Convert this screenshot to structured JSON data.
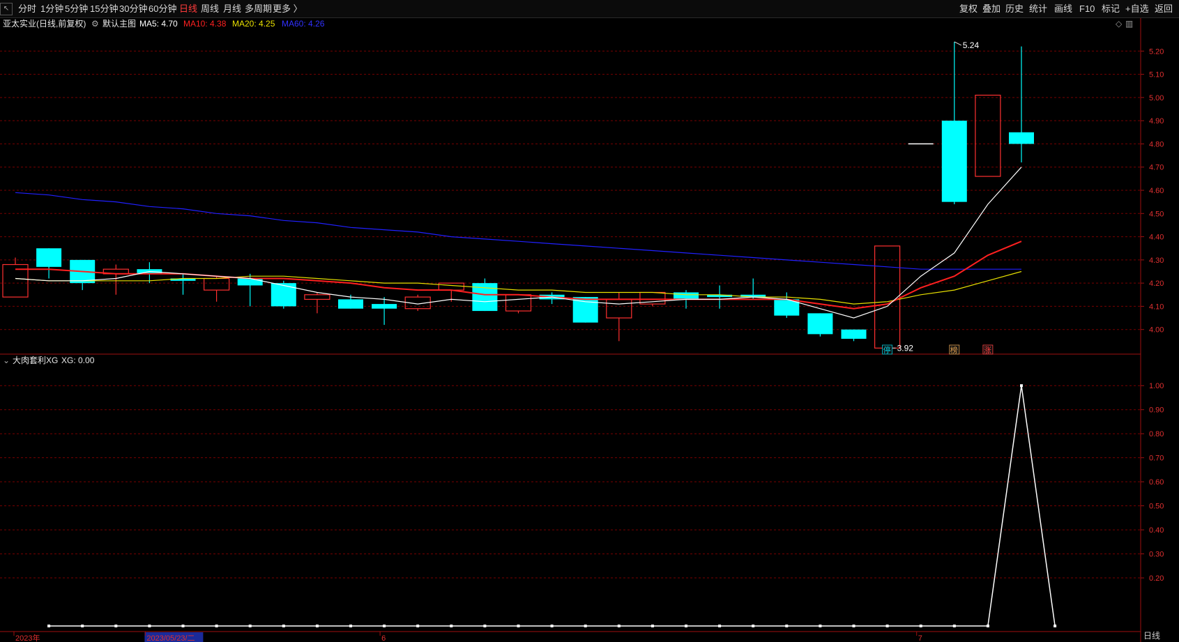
{
  "toolbar": {
    "left_items": [
      "分时",
      "1分钟",
      "5分钟",
      "15分钟",
      "30分钟",
      "60分钟",
      "日线",
      "周线",
      "月线",
      "多周期",
      "更多 〉"
    ],
    "active_item": "日线",
    "right_items": [
      "复权",
      "叠加",
      "历史",
      "统计",
      "画线",
      "F10",
      "标记",
      "+自选",
      "返回"
    ]
  },
  "header": {
    "stock_name": "亚太实业(日线,前复权)",
    "main_chart_label": "默认主图",
    "ma5": "MA5: 4.70",
    "ma10": "MA10: 4.38",
    "ma20": "MA20: 4.25",
    "ma60": "MA60: 4.26"
  },
  "indicator_header": {
    "name": "大肉套利XG",
    "value": "XG: 0.00"
  },
  "colors": {
    "up": "#ff3030",
    "down": "#00ffff",
    "ma5": "#ffffff",
    "ma10": "#ff2020",
    "ma20": "#e8e000",
    "ma60": "#2020ff",
    "grid": "#7a0000",
    "axis_text": "#e03030"
  },
  "chart_data": [
    {
      "type": "candlestick",
      "title": "亚太实业(日线,前复权)",
      "ylim": [
        3.9,
        5.3
      ],
      "yticks": [
        4.0,
        4.1,
        4.2,
        4.3,
        4.4,
        4.5,
        4.6,
        4.7,
        4.8,
        4.9,
        5.0,
        5.1,
        5.2
      ],
      "x_labels": [
        {
          "index": 0,
          "label": "2023年"
        },
        {
          "index": 4,
          "label": "2023/05/23/二"
        },
        {
          "index": 11,
          "label": "6"
        },
        {
          "index": 27,
          "label": "7"
        }
      ],
      "candles": [
        {
          "o": 4.14,
          "h": 4.31,
          "l": 4.14,
          "c": 4.28
        },
        {
          "o": 4.35,
          "h": 4.35,
          "l": 4.22,
          "c": 4.27
        },
        {
          "o": 4.3,
          "h": 4.3,
          "l": 4.17,
          "c": 4.2
        },
        {
          "o": 4.24,
          "h": 4.28,
          "l": 4.15,
          "c": 4.26
        },
        {
          "o": 4.26,
          "h": 4.29,
          "l": 4.2,
          "c": 4.24
        },
        {
          "o": 4.22,
          "h": 4.24,
          "l": 4.15,
          "c": 4.21
        },
        {
          "o": 4.17,
          "h": 4.23,
          "l": 4.12,
          "c": 4.22
        },
        {
          "o": 4.22,
          "h": 4.24,
          "l": 4.1,
          "c": 4.19
        },
        {
          "o": 4.2,
          "h": 4.21,
          "l": 4.09,
          "c": 4.1
        },
        {
          "o": 4.13,
          "h": 4.16,
          "l": 4.07,
          "c": 4.15
        },
        {
          "o": 4.13,
          "h": 4.15,
          "l": 4.09,
          "c": 4.09
        },
        {
          "o": 4.11,
          "h": 4.14,
          "l": 4.02,
          "c": 4.09
        },
        {
          "o": 4.09,
          "h": 4.15,
          "l": 4.08,
          "c": 4.14
        },
        {
          "o": 4.17,
          "h": 4.2,
          "l": 4.12,
          "c": 4.2
        },
        {
          "o": 4.2,
          "h": 4.22,
          "l": 4.08,
          "c": 4.08
        },
        {
          "o": 4.08,
          "h": 4.15,
          "l": 4.07,
          "c": 4.15
        },
        {
          "o": 4.15,
          "h": 4.16,
          "l": 4.11,
          "c": 4.13
        },
        {
          "o": 4.14,
          "h": 4.14,
          "l": 4.03,
          "c": 4.03
        },
        {
          "o": 4.05,
          "h": 4.16,
          "l": 3.95,
          "c": 4.13
        },
        {
          "o": 4.11,
          "h": 4.16,
          "l": 4.1,
          "c": 4.16
        },
        {
          "o": 4.16,
          "h": 4.17,
          "l": 4.09,
          "c": 4.13
        },
        {
          "o": 4.15,
          "h": 4.19,
          "l": 4.09,
          "c": 4.14
        },
        {
          "o": 4.15,
          "h": 4.22,
          "l": 4.13,
          "c": 4.14
        },
        {
          "o": 4.13,
          "h": 4.16,
          "l": 4.05,
          "c": 4.06
        },
        {
          "o": 4.07,
          "h": 4.07,
          "l": 3.97,
          "c": 3.98
        },
        {
          "o": 4.0,
          "h": 4.0,
          "l": 3.95,
          "c": 3.96
        },
        {
          "o": 3.92,
          "h": 4.36,
          "l": 3.92,
          "c": 4.36
        },
        {
          "o": 4.8,
          "h": 4.8,
          "l": 4.8,
          "c": 4.8
        },
        {
          "o": 4.9,
          "h": 5.24,
          "l": 4.54,
          "c": 4.55
        },
        {
          "o": 4.66,
          "h": 5.01,
          "l": 4.66,
          "c": 5.01
        },
        {
          "o": 4.85,
          "h": 5.22,
          "l": 4.72,
          "c": 4.8
        }
      ],
      "ma5": [
        4.22,
        4.21,
        4.21,
        4.22,
        4.25,
        4.24,
        4.23,
        4.22,
        4.19,
        4.16,
        4.14,
        4.13,
        4.11,
        4.13,
        4.12,
        4.13,
        4.14,
        4.12,
        4.11,
        4.12,
        4.13,
        4.13,
        4.14,
        4.13,
        4.09,
        4.05,
        4.1,
        4.23,
        4.33,
        4.54,
        4.7
      ],
      "ma10": [
        4.26,
        4.26,
        4.25,
        4.24,
        4.24,
        4.24,
        4.23,
        4.22,
        4.22,
        4.21,
        4.2,
        4.18,
        4.17,
        4.17,
        4.15,
        4.15,
        4.14,
        4.13,
        4.13,
        4.13,
        4.13,
        4.13,
        4.13,
        4.13,
        4.11,
        4.09,
        4.11,
        4.18,
        4.23,
        4.32,
        4.38
      ],
      "ma20": [
        4.22,
        4.21,
        4.21,
        4.21,
        4.21,
        4.22,
        4.22,
        4.23,
        4.23,
        4.22,
        4.21,
        4.2,
        4.2,
        4.19,
        4.18,
        4.17,
        4.17,
        4.16,
        4.16,
        4.16,
        4.15,
        4.15,
        4.14,
        4.14,
        4.13,
        4.11,
        4.12,
        4.15,
        4.17,
        4.21,
        4.25
      ],
      "ma60": [
        4.59,
        4.58,
        4.56,
        4.55,
        4.53,
        4.52,
        4.5,
        4.49,
        4.47,
        4.46,
        4.44,
        4.43,
        4.42,
        4.4,
        4.39,
        4.38,
        4.37,
        4.36,
        4.35,
        4.34,
        4.33,
        4.32,
        4.31,
        4.3,
        4.29,
        4.28,
        4.27,
        4.26,
        4.26,
        4.26,
        4.26
      ],
      "annotations": [
        {
          "index": 28,
          "text": "5.24",
          "price": 5.24
        },
        {
          "index": 26,
          "text": "3.92",
          "price": 3.92
        }
      ],
      "markers": [
        {
          "index": 26,
          "text": "停",
          "color": "#00c8d8"
        },
        {
          "index": 28,
          "text": "榜",
          "color": "#e0a050"
        },
        {
          "index": 29,
          "text": "涨",
          "color": "#ff4040"
        }
      ]
    },
    {
      "type": "line",
      "title": "大肉套利XG",
      "ylim": [
        0,
        1.05
      ],
      "yticks": [
        0.2,
        0.3,
        0.4,
        0.5,
        0.6,
        0.7,
        0.8,
        0.9,
        1.0
      ],
      "series": [
        {
          "name": "XG",
          "values": [
            0,
            0,
            0,
            0,
            0,
            0,
            0,
            0,
            0,
            0,
            0,
            0,
            0,
            0,
            0,
            0,
            0,
            0,
            0,
            0,
            0,
            0,
            0,
            0,
            0,
            0,
            0,
            0,
            0,
            1,
            0
          ]
        }
      ]
    }
  ],
  "mode_label": "日线"
}
